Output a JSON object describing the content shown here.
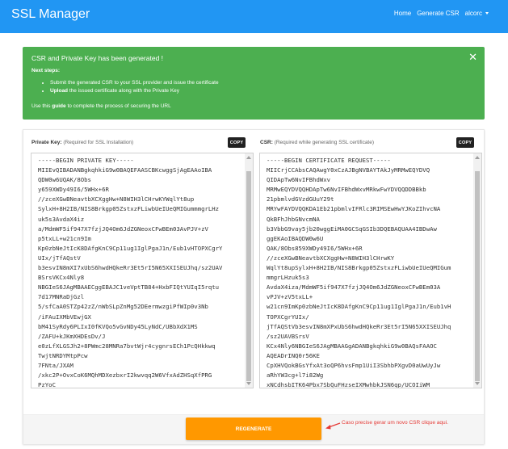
{
  "navbar": {
    "brand": "SSL Manager",
    "links": [
      "Home",
      "Generate CSR",
      "alcorc"
    ]
  },
  "alert": {
    "title": "CSR and Private Key has been generated !",
    "close_icon": "close-icon",
    "subtitle": "Next steps:",
    "step1": "Submit the generated CSR to your SSL provider and issue the certificate",
    "step2_bold": "Upload",
    "step2_rest": " the issued certificate along with the Private Key",
    "footer_pre": "Use this ",
    "footer_bold": "guide",
    "footer_post": " to complete the process of securing the URL",
    "color": "#4caf50"
  },
  "private_key": {
    "label": "Private Key:",
    "note": " (Required for SSL Installation)",
    "copy_label": "COPY",
    "text": "-----BEGIN PRIVATE KEY-----\nMIIEvQIBADANBgkqhkiG9w0BAQEFAASCBKcwggSjAgEAAoIBA\nQDW0w6UQAK/8Obs\ny659XWDy49I6/5WHx+6R\n//zceXGwBNeavtbXCXggHw+N8WIH3lCHrwKYWqlYt8up\nSylxH+8H2IB/NIS8Brkgp05ZstxzFLiwbUeIUeQMIGummmgrLHz\nuk5s3AvdaX4iz\na/MdmWF5if947X7fzjJQ4Om6JdZGNeoxCFwBEm03AvPJV+zV\np5txLL+w21cn9Im\nKp0zbNeJtIcK8DAfgKnC9Cp11ug1IglPgaJ1n/Eub1vHTOPXCgrY\nUIx/jTfAQstV\nb3esvIN8mXI7xUbS6hwdHQkeRr3Et5rI5N65XXISEUJhq/sz2UAV\nBSrsVKCx4Nly8\nNBGIeS6JAgMBAAECggEBAJC1veVptTB84+HxbFIQtYUIqI5rqtu\n7d17MNRaDjGzl\n5/sfCaA0STZp42zZ/nWbSLpZnMg52DEermwzgiPfWIp0v3Nb\n/iFAuIXMbVEwjGX\nbM41SyRdy6PLIxI0fKVQo5vGvNDy45LyNdC/UBbXdX1MS\n/ZAFU+kJKmXHDEsDv/J\ne0zLfXLGSJh2+8PWmc28MNRa7bvtWjr4cygnrsECh1PcQHkkwq\nTwjtNRDYMtpPcw\n7FNta/JXAM\n/xkc2P+OvxCoK6MQhMDXezbxrI2kwvqq2W6VfxAdZHSqXfPRG\nPzYoC"
  },
  "csr": {
    "label": "CSR:",
    "note": " (Required while generating SSL certificate)",
    "copy_label": "COPY",
    "text": "-----BEGIN CERTIFICATE REQUEST-----\nMIICrjCCAbsCAQAwgY0xCzAJBgNVBAYTAkJyMRMwEQYDVQ\nQIDApTw6NvIFBhdWxv\nMRMwEQYDVQQHDApTw6NvIFBhdWxvMRkwFwYDVQQDDBBkb\n21pbmlvdGVzdGUuY29t\nMRYwFAYDVQQKDA1Eb21pbmlvIFRlc3RIMSEwHwYJKoZIhvcNA\nQkBFhJhbGNvcmNA\nb3VbbG9vay5jb20wggEiMA0GCSqGSIb3DQEBAQUAA4IBDwAw\nggEKAoIBAQDW0w6U\nQAK/8Obs859XWDy49I6/5WHx+6R\n//zceXGwBNeavtbXCXggHw+N8WIH3lCHrwKY\nWqlYt8upSylxH+8H2IB/NIS8Brkgp05ZstxzFLiwbUeIUeQMIGum\nmmgrLHzuk5s3\nAvdaX4iza/MdmWF5if947X7fzjJQ4Om6JdZGNeoxCFwBEm03A\nvPJV+zV5txLL+\nw21cn9ImKp0zbNeJtIcK8DAfgKnC9Cp11ug1IglPgaJ1n/Eub1vH\nTOPXCgrYUIx/\njTfAQStVb3esvIN8mXPxUbS6hwdHQkeRr3Et5rI5N65XXISEUJhq\n/sz2UAVBSrsV\nKCx4Nly6NBGIeS6JAgMBAAGgADANBgkqhkiG9w0BAQsFAAOC\nAQEADrINQ0r56KE\nCpXHVQokBGsYfxAt3oQP6hvsFmp1UiI3SbhbPXgvD0aUwUyJw\naRhYW3cg+l7i82Wg\nxNCdhsbITK64Pbx7SbQuFHzseIXMwhbkJSN6qp/UCOIiWM"
  },
  "regenerate": {
    "label": "REGENERATE",
    "color": "#ff9800",
    "hint_icon": "arrow-left-icon",
    "hint": "Caso precise gerar um novo CSR clique aqui."
  }
}
